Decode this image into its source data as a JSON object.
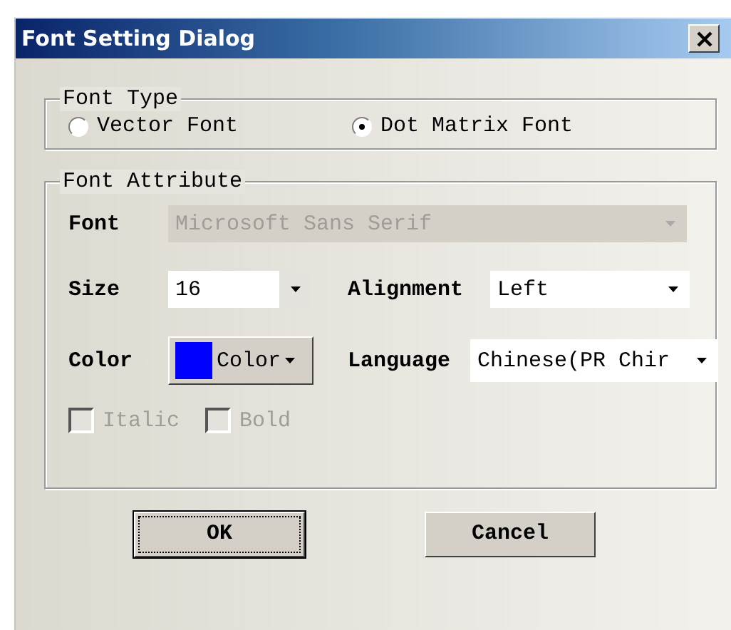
{
  "window": {
    "title": "Font Setting Dialog"
  },
  "font_type": {
    "label": "Font Type",
    "options": [
      {
        "label": "Vector Font",
        "selected": false
      },
      {
        "label": "Dot Matrix Font",
        "selected": true
      }
    ]
  },
  "font_attribute": {
    "label": "Font Attribute",
    "font": {
      "label": "Font",
      "value": "Microsoft Sans Serif",
      "disabled": true
    },
    "size": {
      "label": "Size",
      "value": "16"
    },
    "alignment": {
      "label": "Alignment",
      "value": "Left"
    },
    "color": {
      "label": "Color",
      "button": "Color",
      "color": "#0000ff"
    },
    "language": {
      "label": "Language",
      "value": "Chinese(PR Chir"
    },
    "checkboxes": [
      {
        "label": "Italic",
        "checked": false,
        "disabled": true
      },
      {
        "label": "Bold",
        "checked": false,
        "disabled": true
      }
    ]
  },
  "buttons": [
    {
      "label": "OK",
      "default": true
    },
    {
      "label": "Cancel",
      "default": false
    }
  ]
}
